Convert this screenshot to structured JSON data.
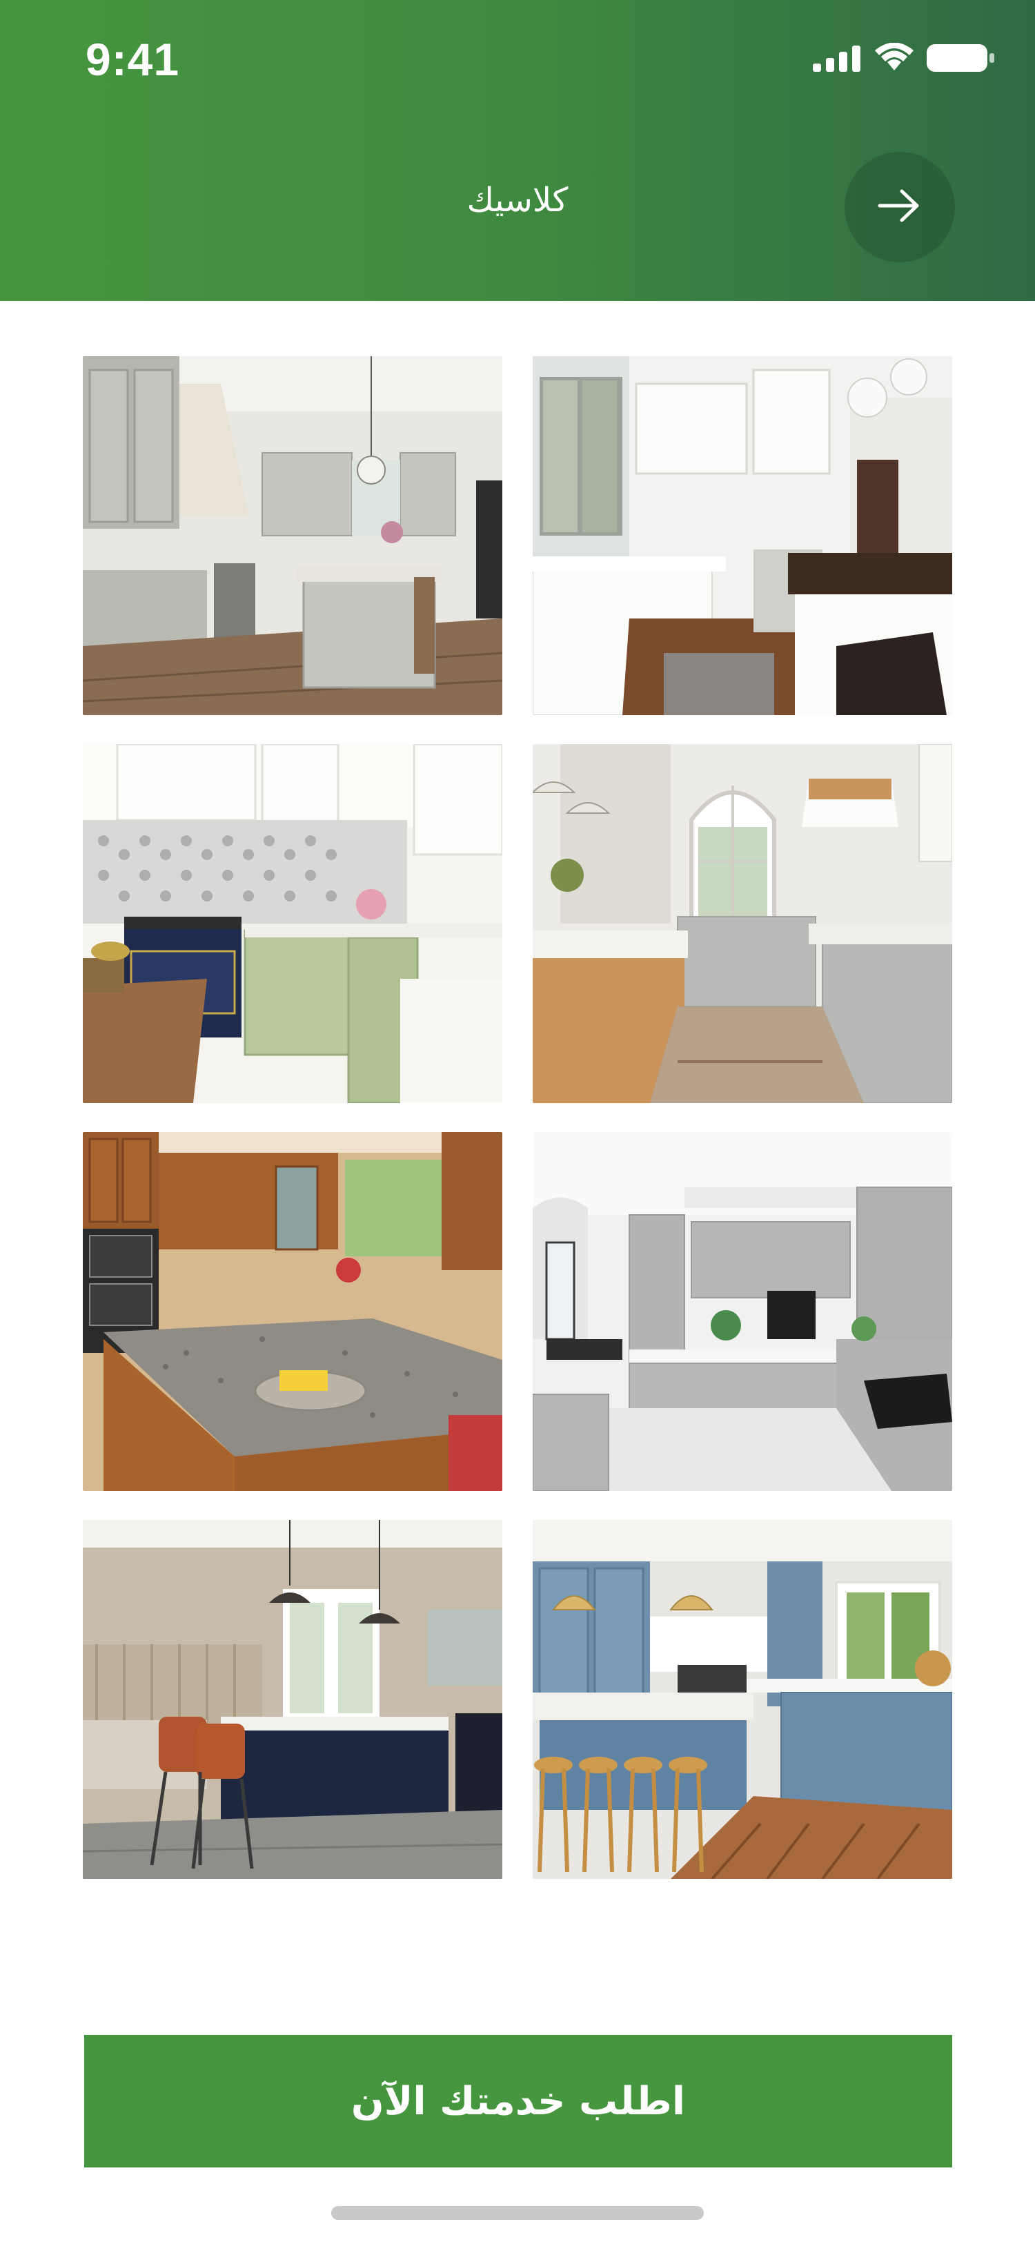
{
  "status_bar": {
    "time": "9:41",
    "icons": [
      "cellular-signal-icon",
      "wifi-icon",
      "battery-icon"
    ]
  },
  "header": {
    "title": "كلاسيك",
    "back_icon": "arrow-right-icon",
    "gradient": [
      "#46963f",
      "#2f6a43"
    ]
  },
  "gallery": {
    "items": [
      {
        "name": "kitchen-photo-1",
        "description": "grey classic kitchen with island"
      },
      {
        "name": "kitchen-photo-2",
        "description": "white kitchen with wood countertop"
      },
      {
        "name": "kitchen-photo-3",
        "description": "sage green kitchen with navy range"
      },
      {
        "name": "kitchen-photo-4",
        "description": "grey kitchen with arched window"
      },
      {
        "name": "kitchen-photo-5",
        "description": "wood cabinets with granite island"
      },
      {
        "name": "kitchen-photo-6",
        "description": "light grey modern kitchen"
      },
      {
        "name": "kitchen-photo-7",
        "description": "navy island with orange stools"
      },
      {
        "name": "kitchen-photo-8",
        "description": "blue kitchen with rattan stools"
      }
    ]
  },
  "cta": {
    "label": "اطلب خدمتك الآن",
    "color": "#46963f"
  }
}
